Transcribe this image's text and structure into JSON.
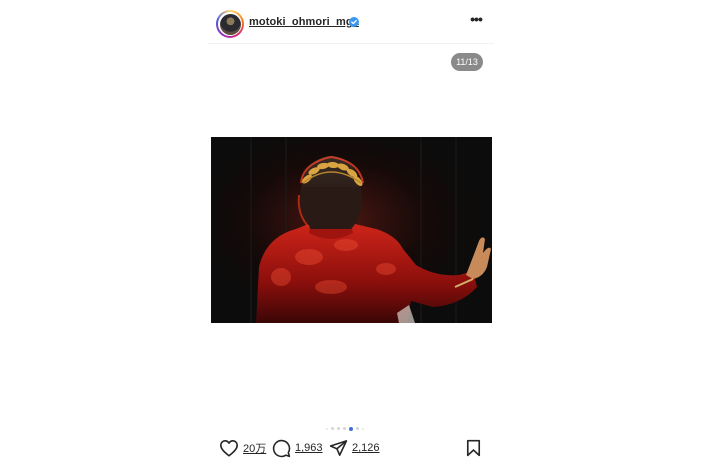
{
  "post": {
    "username": "motoki_ohmori_mga",
    "verified": true,
    "image_counter": "11/13",
    "carousel": {
      "total_dots_visible": 7,
      "active_index": 4
    },
    "photo": {
      "subject": "performer in red jacket with gold laurel crown, back view, raised hand"
    },
    "actions": {
      "likes": "20万",
      "comments": "1,963",
      "shares": "2,126"
    },
    "icons": {
      "more": "more-options-icon",
      "like": "heart-icon",
      "comment": "comment-icon",
      "share": "send-icon",
      "save": "bookmark-icon",
      "verified": "verified-badge-icon"
    },
    "colors": {
      "text": "#262626",
      "verified_blue": "#3897f0",
      "active_dot": "#3f6fe0",
      "counter_bg": "#8a8a8a"
    }
  }
}
